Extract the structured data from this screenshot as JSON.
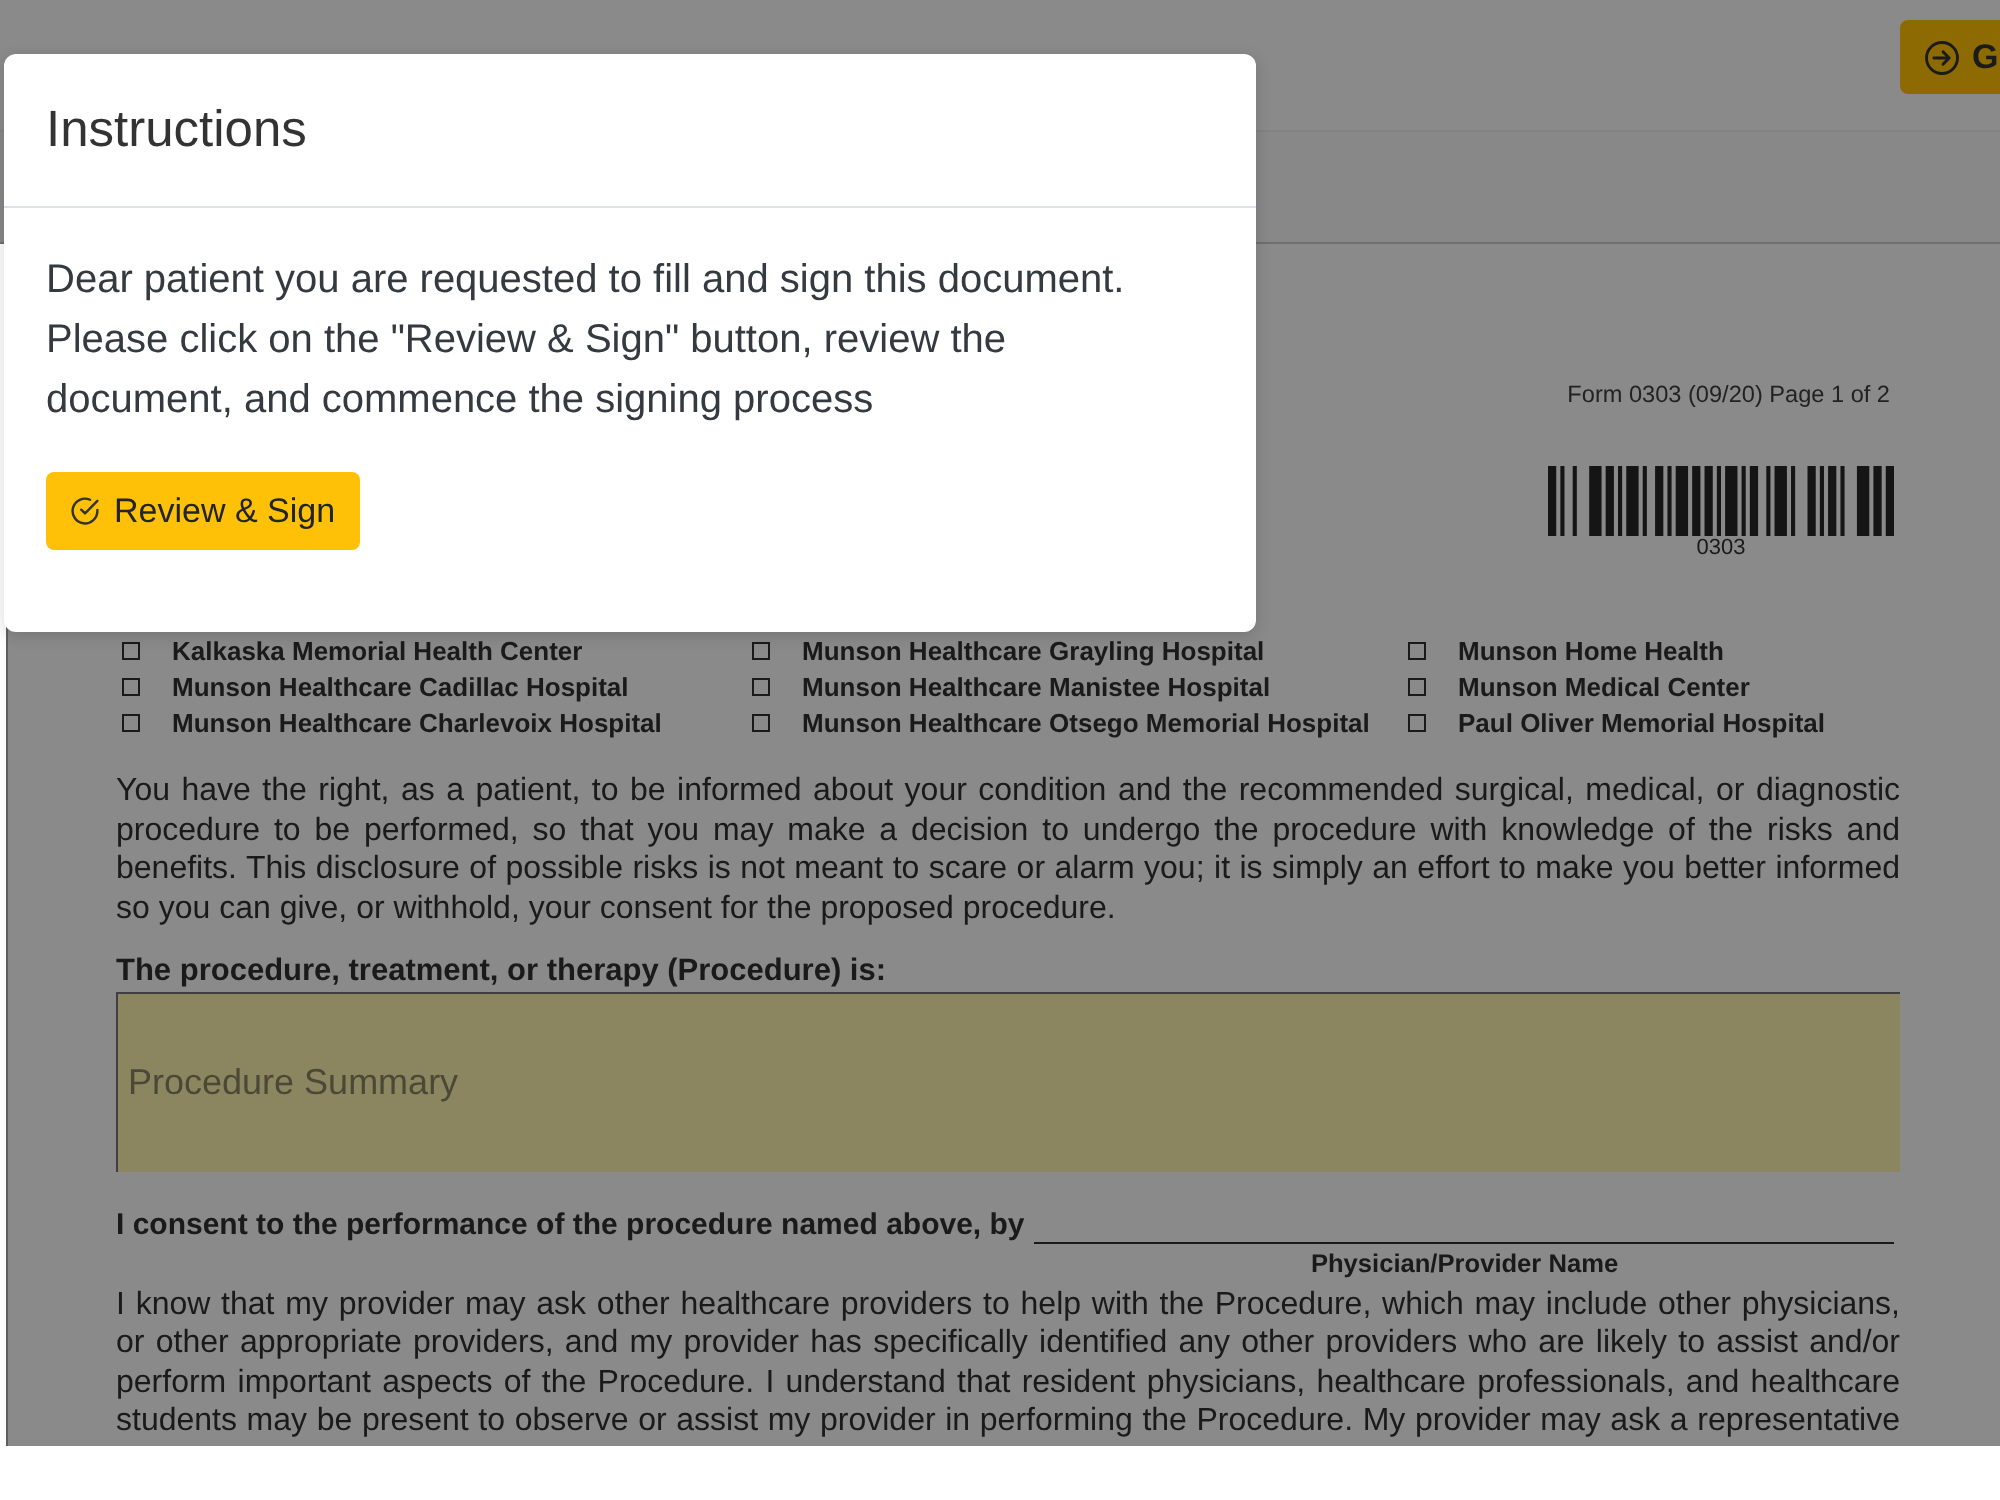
{
  "topbar": {
    "button": {
      "label": "G"
    }
  },
  "document": {
    "form_info": "Form 0303 (09/20) Page 1 of 2",
    "barcode_number": "0303",
    "facilities": [
      {
        "name": "Kalkaska Memorial Health Center",
        "checked": false
      },
      {
        "name": "Munson Healthcare Cadillac Hospital",
        "checked": false
      },
      {
        "name": "Munson Healthcare Charlevoix Hospital",
        "checked": false
      },
      {
        "name": "Munson Healthcare Grayling Hospital",
        "checked": false
      },
      {
        "name": "Munson Healthcare Manistee Hospital",
        "checked": false
      },
      {
        "name": "Munson Healthcare Otsego Memorial Hospital",
        "checked": false
      },
      {
        "name": "Munson Home Health",
        "checked": false
      },
      {
        "name": "Munson Medical Center",
        "checked": false
      },
      {
        "name": "Paul Oliver Memorial Hospital",
        "checked": false
      }
    ],
    "intro": "You have the right, as a patient, to be informed about your condition and the recommended surgical, medical, or diagnostic procedure to be performed, so that you may make a decision to undergo the procedure with knowledge of the risks and benefits. This disclosure of possible risks is not meant to scare or alarm you; it is simply an effort to make you better informed so you can give, or withhold, your consent for the proposed procedure.",
    "procedure_heading": "The procedure, treatment, or therapy (Procedure) is:",
    "procedure_field": {
      "placeholder": "Procedure Summary"
    },
    "consent_statement": "I consent to the performance of the procedure named above, by",
    "provider_caption": "Physician/Provider Name",
    "providers_paragraph": "I know that my provider may ask other healthcare providers to help with the Procedure, which may include other physicians, or other appropriate providers, and my provider has specifically identified any other providers who are likely to assist and/or perform important aspects of the Procedure. I understand that resident physicians, healthcare professionals, and healthcare students may be present to observe or assist my provider in performing the Procedure. My provider may ask a representative"
  },
  "modal": {
    "title": "Instructions",
    "message": "Dear patient you are requested to fill and sign this document. Please click on the \"Review & Sign\" button, review the document, and commence the signing process",
    "button": {
      "label": "Review & Sign"
    }
  }
}
